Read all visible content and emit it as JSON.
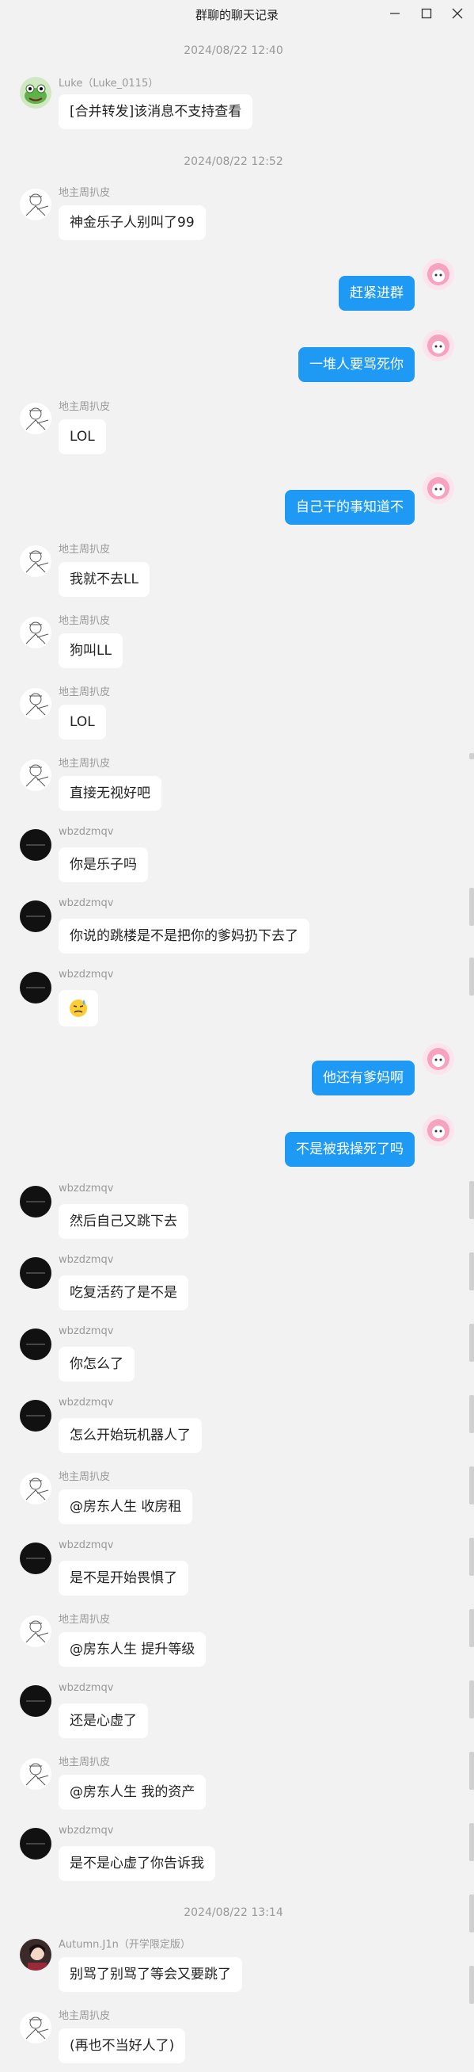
{
  "window": {
    "title": "群聊的聊天记录",
    "minimize_label": "—",
    "maximize_label": "□",
    "close_label": "✕"
  },
  "chat": {
    "timestamps": [
      "2024/08/22 12:40",
      "2024/08/22 12:52",
      "2024/08/22 13:14"
    ],
    "senders": {
      "luke": "Luke（Luke_0115）",
      "dizhu": "地主周扒皮",
      "wbz": "wbzdzmqv",
      "autumn": "Autumn.J1n（开学限定版）"
    },
    "messages": [
      "[合并转发]该消息不支持查看",
      "神金乐子人别叫了99",
      "赶紧进群",
      "一堆人要骂死你",
      "LOL",
      "自己干的事知道不",
      "我就不去LL",
      "狗叫LL",
      "LOL",
      "直接无视好吧",
      "你是乐子吗",
      "你说的跳楼是不是把你的爹妈扔下去了",
      "😓",
      "他还有爹妈啊",
      "不是被我操死了吗",
      "然后自己又跳下去",
      "吃复活药了是不是",
      "你怎么了",
      "怎么开始玩机器人了",
      "@房东人生 收房租",
      "是不是开始畏惧了",
      "@房东人生 提升等级",
      "还是心虚了",
      "@房东人生 我的资产",
      "是不是心虚了你告诉我",
      "别骂了别骂了等会又要跳了",
      "(再也不当好人了)"
    ]
  },
  "colors": {
    "background": "#f2f2f2",
    "incoming_bubble": "#ffffff",
    "outgoing_bubble": "#1e9af5",
    "timestamp_text": "#999999"
  },
  "icons": {
    "minimize": "minimize-icon",
    "maximize": "maximize-icon",
    "close": "close-icon"
  }
}
